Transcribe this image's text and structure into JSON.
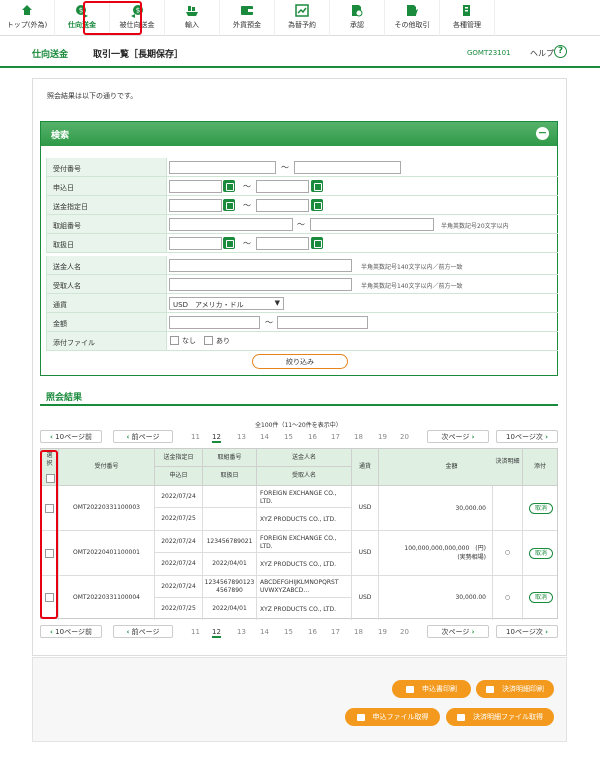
{
  "nav": [
    {
      "label": "トップ(外為)",
      "icon": "home-icon"
    },
    {
      "label": "仕向送金",
      "icon": "send-money-icon",
      "selected": true
    },
    {
      "label": "被仕向送金",
      "icon": "receive-money-icon"
    },
    {
      "label": "輸入",
      "icon": "ship-icon"
    },
    {
      "label": "外貨預金",
      "icon": "wallet-icon"
    },
    {
      "label": "為替予約",
      "icon": "chart-icon"
    },
    {
      "label": "承認",
      "icon": "approve-icon"
    },
    {
      "label": "その他取引",
      "icon": "other-icon"
    },
    {
      "label": "各種管理",
      "icon": "manage-icon"
    }
  ],
  "header": {
    "section": "仕向送金",
    "title": "取引一覧［長期保存］",
    "code": "GOMT23101",
    "help": "ヘルプ",
    "help_icon": "?"
  },
  "message": "照会結果は以下の通りです。",
  "search": {
    "title": "検索",
    "collapse_icon": "−",
    "tilde": "～",
    "labels": [
      "受付番号",
      "申込日",
      "送金指定日",
      "取組番号",
      "取扱日",
      "送金人名",
      "受取人名",
      "通貨",
      "金額",
      "添付ファイル"
    ],
    "hint_20": "半角英数記号20文字以内",
    "hint_140a": "半角英数記号140文字以内／前方一致",
    "hint_140b": "半角英数記号140文字以内／前方一致",
    "currency": "USD　アメリカ・ドル",
    "attach_none": "なし",
    "attach_yes": "あり",
    "filter_button": "絞り込み"
  },
  "results": {
    "title": "照会結果",
    "count": "全100件（11〜20件を表示中）",
    "prev10": "10ページ前",
    "prev": "前ページ",
    "next": "次ページ",
    "next10": "10ページ次",
    "pages": [
      "11",
      "12",
      "13",
      "14",
      "15",
      "16",
      "17",
      "18",
      "19",
      "20"
    ],
    "current_page": "12",
    "headers": {
      "select": "選択",
      "ref": "受付番号",
      "send_date": "送金指定日",
      "apply_date": "申込日",
      "deal_no": "取組番号",
      "handle_date": "取扱日",
      "sender": "送金人名",
      "receiver": "受取人名",
      "currency": "通貨",
      "amount": "金額",
      "statement": "決済明細",
      "attach": "添付"
    },
    "rows": [
      {
        "ref": "OMT20220331100003",
        "send_date": "2022/07/24",
        "apply_date": "2022/07/25",
        "deal_no": "",
        "handle_date": "",
        "sender": "FOREIGN EXCHANGE CO., LTD.",
        "receiver": "XYZ PRODUCTS CO., LTD.",
        "currency": "USD",
        "amount": "30,000.00",
        "amount_note": "",
        "statement": "",
        "attach": "取消"
      },
      {
        "ref": "OMT20220401100001",
        "send_date": "2022/07/24",
        "apply_date": "2022/07/24",
        "deal_no": "123456789021",
        "handle_date": "2022/04/01",
        "sender": "FOREIGN EXCHANGE CO., LTD.",
        "receiver": "XYZ PRODUCTS CO., LTD.",
        "currency": "USD",
        "amount": "100,000,000,000,000　(円)",
        "amount_note": "(実勢相場)",
        "statement": "○",
        "attach": "取消"
      },
      {
        "ref": "OMT20220331100004",
        "send_date": "2022/07/24",
        "apply_date": "2022/07/25",
        "deal_no": "1234567890123 4567890",
        "handle_date": "2022/04/01",
        "sender": "ABCDEFGHIJKLMNOPQRST UVWXYZABCD…",
        "receiver": "XYZ PRODUCTS CO., LTD.",
        "currency": "USD",
        "amount": "30,000.00",
        "amount_note": "",
        "statement": "○",
        "attach": "取消"
      }
    ]
  },
  "actions": {
    "print_apply": "申込書印刷",
    "print_statement": "決済明細印刷",
    "get_apply_file": "申込ファイル取得",
    "get_statement_file": "決済明細ファイル取得"
  },
  "colors": {
    "brand": "#1a8a3c",
    "accent": "#f39a1e",
    "highlight": "#e60012"
  }
}
